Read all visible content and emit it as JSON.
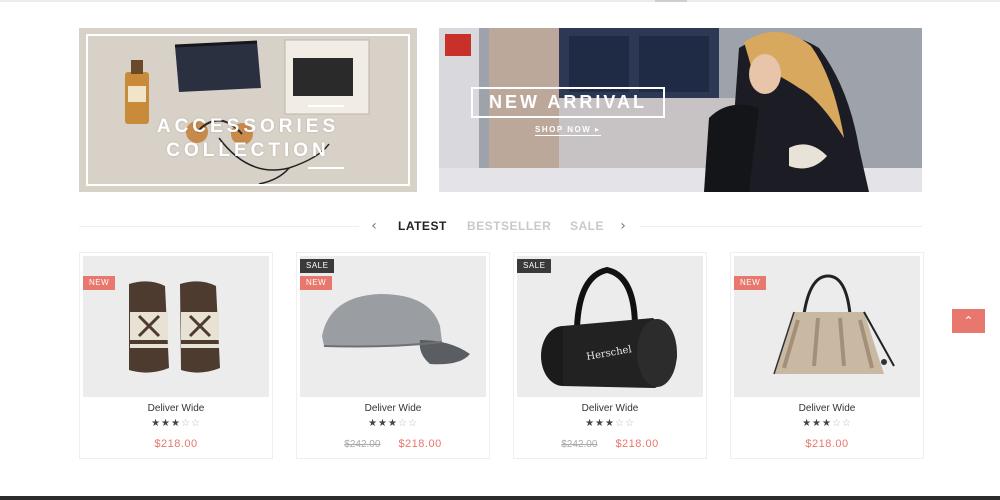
{
  "banners": {
    "accessories": {
      "line1": "ACCESSORIES",
      "line2": "COLLECTION"
    },
    "new_arrival": {
      "title": "NEW ARRIVAL",
      "cta": "SHOP NOW ▸"
    }
  },
  "tabs": {
    "prev_icon": "chevron-left-icon",
    "next_icon": "chevron-right-icon",
    "items": [
      "LATEST",
      "BESTSELLER",
      "SALE"
    ],
    "active": "LATEST"
  },
  "products": [
    {
      "name": "Deliver Wide",
      "badges": [
        "NEW"
      ],
      "rating": 3,
      "max_rating": 5,
      "old_price": "",
      "price": "$218.00"
    },
    {
      "name": "Deliver Wide",
      "badges": [
        "SALE",
        "NEW"
      ],
      "rating": 3,
      "max_rating": 5,
      "old_price": "$242.00",
      "price": "$218.00"
    },
    {
      "name": "Deliver Wide",
      "badges": [
        "SALE"
      ],
      "rating": 3,
      "max_rating": 5,
      "old_price": "$242.00",
      "price": "$218.00"
    },
    {
      "name": "Deliver Wide",
      "badges": [
        "NEW"
      ],
      "rating": 3,
      "max_rating": 5,
      "old_price": "",
      "price": "$218.00"
    }
  ],
  "back_to_top_icon": "chevron-up-icon",
  "colors": {
    "accent": "#e8776d",
    "sale_badge": "#3a3a3a",
    "text": "#333333"
  }
}
